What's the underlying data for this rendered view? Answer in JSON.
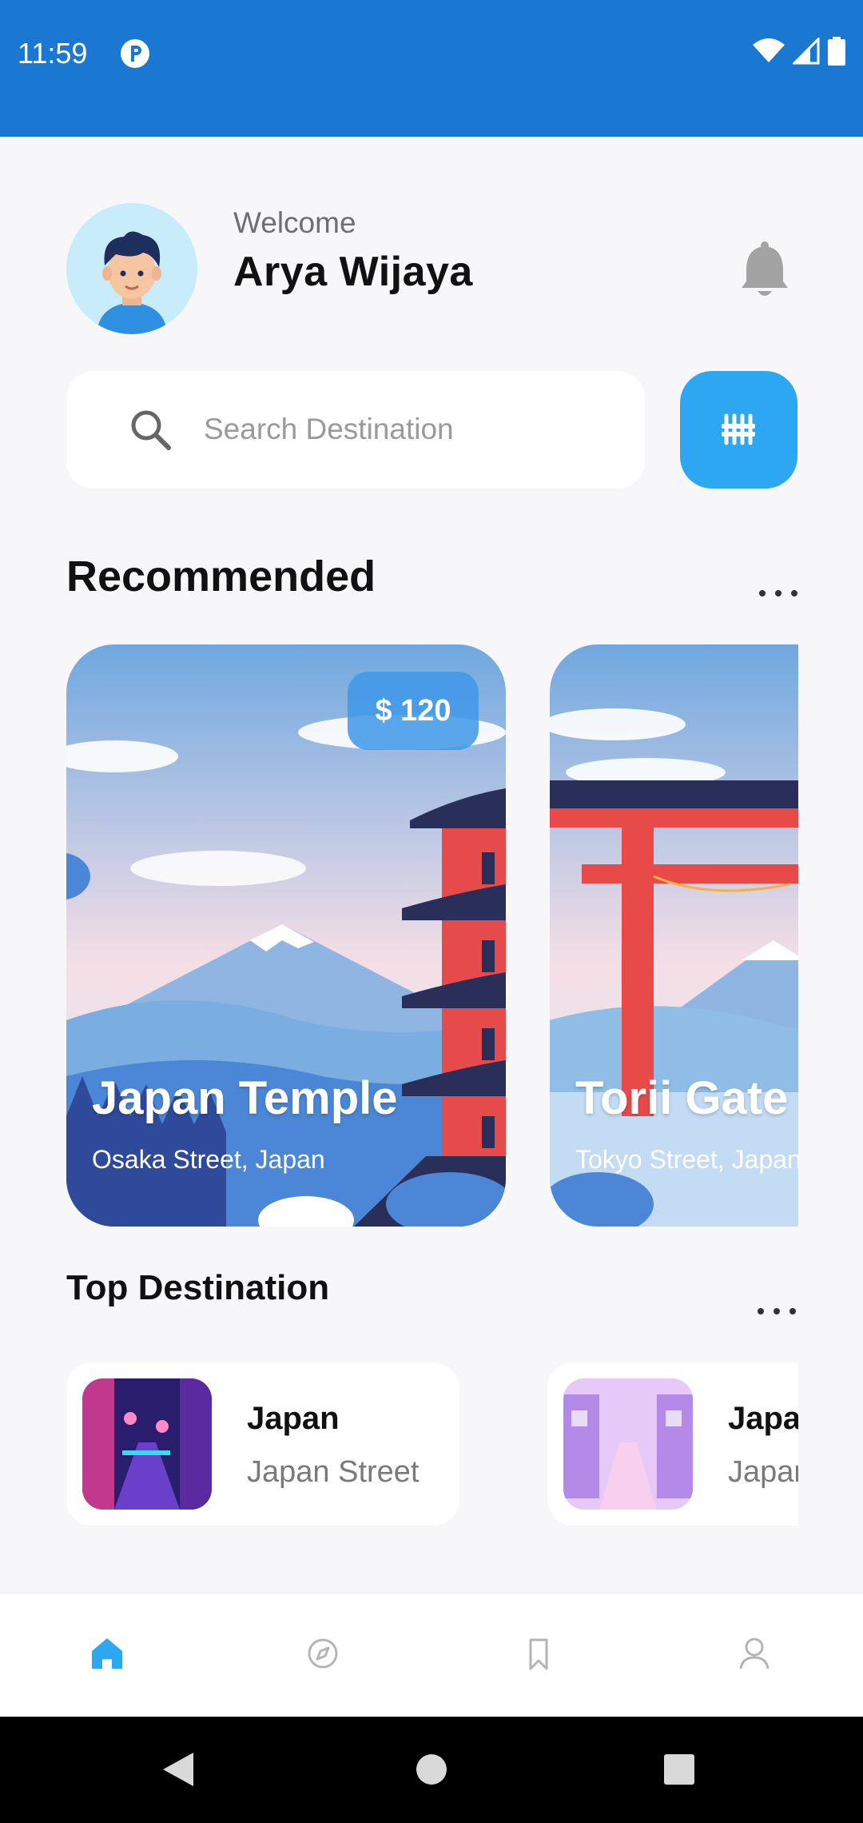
{
  "status_bar": {
    "time": "11:59"
  },
  "header": {
    "welcome": "Welcome",
    "user_name": "Arya Wijaya"
  },
  "search": {
    "placeholder": "Search Destination"
  },
  "recommended": {
    "title": "Recommended",
    "cards": [
      {
        "name": "Japan Temple",
        "location": "Osaka Street, Japan",
        "price": "$ 120"
      },
      {
        "name": "Torii Gate",
        "location": "Tokyo Street, Japan"
      }
    ]
  },
  "top_destination": {
    "title": "Top Destination",
    "items": [
      {
        "name": "Japan",
        "subtitle": "Japan Street"
      },
      {
        "name": "Japan",
        "subtitle": "Japan Street"
      }
    ]
  },
  "nav": {
    "active": "home",
    "items": [
      "home-icon",
      "explore-icon",
      "bookmark-icon",
      "profile-icon"
    ]
  },
  "colors": {
    "status_bar": "#1a78d2",
    "accent": "#2ea7f2",
    "background": "#f7f7f9"
  }
}
